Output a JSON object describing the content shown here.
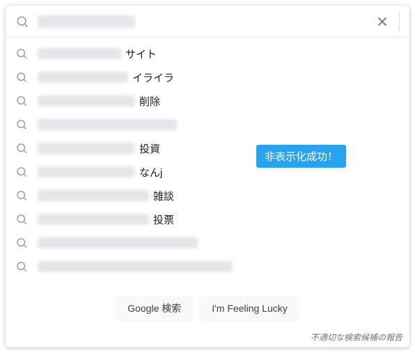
{
  "search": {
    "query_hidden": true,
    "placeholder": ""
  },
  "suggestions": [
    {
      "hidden_width": 120,
      "suffix": "サイト"
    },
    {
      "hidden_width": 130,
      "suffix": "イライラ"
    },
    {
      "hidden_width": 140,
      "suffix": "削除"
    },
    {
      "hidden_width": 200,
      "suffix": ""
    },
    {
      "hidden_width": 140,
      "suffix": "投資"
    },
    {
      "hidden_width": 140,
      "suffix": "なんj"
    },
    {
      "hidden_width": 160,
      "suffix": "雑談"
    },
    {
      "hidden_width": 160,
      "suffix": "投票"
    },
    {
      "hidden_width": 230,
      "suffix": ""
    },
    {
      "hidden_width": 280,
      "suffix": ""
    }
  ],
  "callout": {
    "text": "非表示化成功！"
  },
  "buttons": {
    "search_label": "Google 検索",
    "lucky_label": "I'm Feeling Lucky"
  },
  "report_link": "不適切な検索候補の報告"
}
